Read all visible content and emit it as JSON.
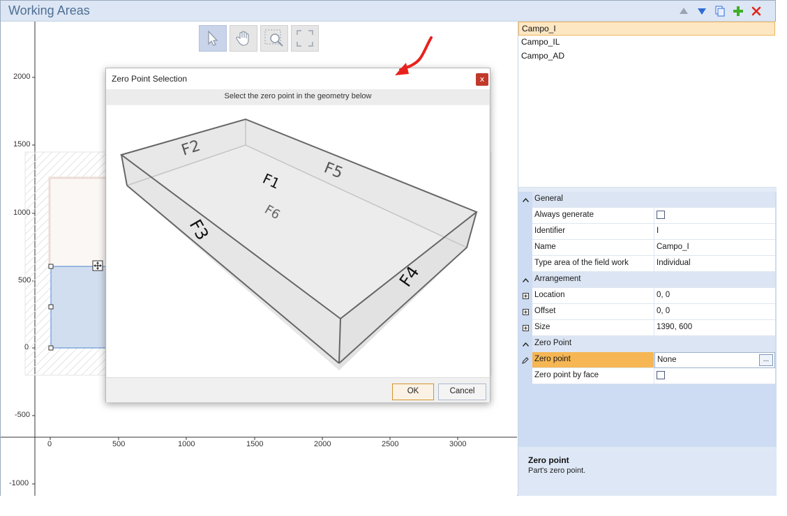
{
  "window": {
    "title": "Working Areas"
  },
  "toolbar_icons": [
    "move-up-icon",
    "move-down-icon",
    "copy-icon",
    "add-icon",
    "delete-icon"
  ],
  "view_tools": [
    "pointer-tool-icon",
    "pan-hand-icon",
    "zoom-tool-icon",
    "fit-view-icon"
  ],
  "axes": {
    "y_ticks": [
      "2000",
      "1500",
      "1000",
      "500",
      "0",
      "-500",
      "-1000"
    ],
    "x_ticks": [
      "0",
      "500",
      "1000",
      "1500",
      "2000",
      "2500",
      "3000"
    ]
  },
  "areas_list": {
    "items": [
      "Campo_I",
      "Campo_IL",
      "Campo_AD"
    ],
    "selected": 0
  },
  "properties": {
    "general": {
      "label": "General",
      "always_generate": "Always generate",
      "identifier_label": "Identifier",
      "identifier_value": "I",
      "name_label": "Name",
      "name_value": "Campo_I",
      "type_label": "Type area of the field work",
      "type_value": "Individual"
    },
    "arrangement": {
      "label": "Arrangement",
      "location_label": "Location",
      "location_value": "0, 0",
      "offset_label": "Offset",
      "offset_value": "0, 0",
      "size_label": "Size",
      "size_value": "1390, 600"
    },
    "zero_point": {
      "label": "Zero Point",
      "zero_point_label": "Zero point",
      "zero_point_value": "None",
      "ellipsis": "...",
      "by_face_label": "Zero point by face"
    }
  },
  "description": {
    "title": "Zero point",
    "text": "Part's zero point."
  },
  "dialog": {
    "title": "Zero Point Selection",
    "close": "x",
    "instruction": "Select the zero point in the geometry below",
    "faces": [
      "F1",
      "F2",
      "F3",
      "F4",
      "F5",
      "F6"
    ],
    "ok": "OK",
    "cancel": "Cancel"
  },
  "colors": {
    "accent_orange": "#f5b653",
    "close_red": "#c0392b",
    "annotation_arrow": "#e8211d"
  }
}
